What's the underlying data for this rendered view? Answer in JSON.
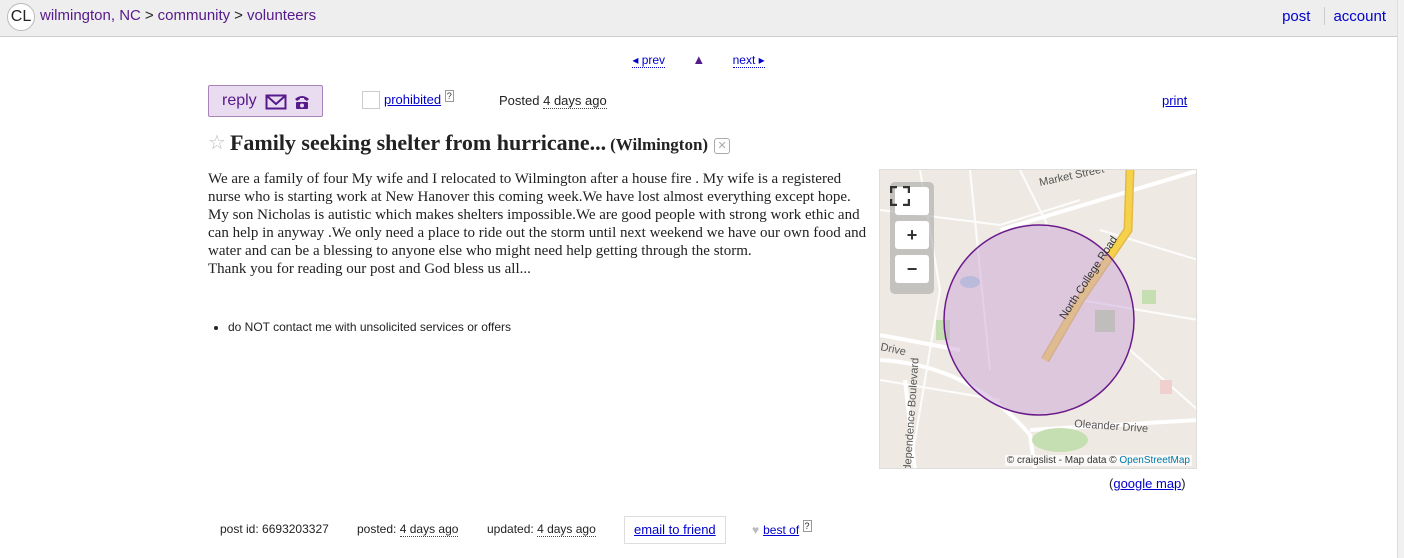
{
  "header": {
    "logo": "CL",
    "breadcrumbs": [
      "wilmington, NC",
      "community",
      "volunteers"
    ],
    "separator": ">",
    "post_label": "post",
    "account_label": "account"
  },
  "nav": {
    "prev": "◂ prev",
    "up": "▲",
    "next": "next ▸"
  },
  "actions": {
    "reply_label": "reply",
    "prohibited_label": "prohibited",
    "prohibited_help": "?",
    "posted_label": "Posted",
    "posted_value": "4 days ago",
    "print_label": "print"
  },
  "posting": {
    "title": "Family seeking shelter from hurricane...",
    "location": "(Wilmington)",
    "body": "We are a family of four My wife and I relocated to Wilmington after a house fire . My wife is a registered nurse who is starting work at New Hanover this coming week.We have lost almost everything except hope. My son Nicholas is autistic which makes shelters impossible.We are good people with strong work ethic and can help in anyway .We only need a place to ride out the storm until next weekend we have our own food and water and can be a blessing to anyone else who might need help getting through the storm.",
    "closing": "Thank you for reading our post and God bless us all...",
    "notices": [
      "do NOT contact me with unsolicited services or offers"
    ]
  },
  "map": {
    "labels": {
      "market": "Market Street",
      "north_college": "North College Road",
      "drive": "Drive",
      "oleander": "Oleander Drive",
      "independence": "Independence Boulevard"
    },
    "attribution_prefix": "© craigslist - Map data ©",
    "attribution_link": "OpenStreetMap",
    "zoom_in": "+",
    "zoom_out": "−",
    "google_map_label": "google map"
  },
  "footer": {
    "post_id_label": "post id:",
    "post_id": "6693203327",
    "posted_label": "posted:",
    "posted_value": "4 days ago",
    "updated_label": "updated:",
    "updated_value": "4 days ago",
    "email_friend": "email to friend",
    "best_of": "best of",
    "best_of_help": "?"
  },
  "colors": {
    "link": "#0000cc",
    "visited": "#551a8b",
    "reply_bg": "#eadcf0",
    "circle_fill": "#c9a4d6",
    "road_yellow": "#f5d24a"
  },
  "icons": {
    "reply_mail": "mail-icon",
    "reply_phone": "phone-icon",
    "favorite": "star-icon",
    "hide": "hide-icon",
    "heart": "heart-icon",
    "fullscreen": "fullscreen-icon"
  }
}
